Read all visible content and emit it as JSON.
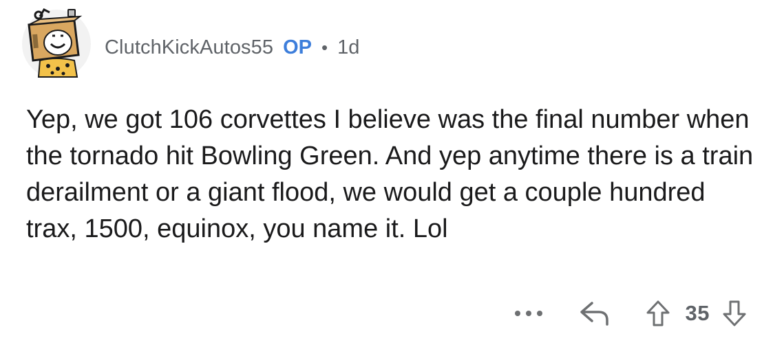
{
  "comment": {
    "author": "ClutchKickAutos55",
    "badge": "OP",
    "separator": "•",
    "age": "1d",
    "body": "Yep, we got 106 corvettes I believe was the final number when the tornado hit Bowling Green. And yep anytime there is a train derailment or a giant flood, we would get a couple hundred trax, 1500, equinox, you name it. Lol",
    "score": "35"
  },
  "icons": {
    "avatar": "cardboard-box-robot-avatar",
    "more": "ellipsis-icon",
    "reply": "reply-arrow-icon",
    "upvote": "upvote-arrow-icon",
    "downvote": "downvote-arrow-icon"
  },
  "colors": {
    "username": "#5f6368",
    "op_badge": "#3d7edb",
    "body_text": "#1a1a1b",
    "icon_gray": "#6e7072"
  }
}
